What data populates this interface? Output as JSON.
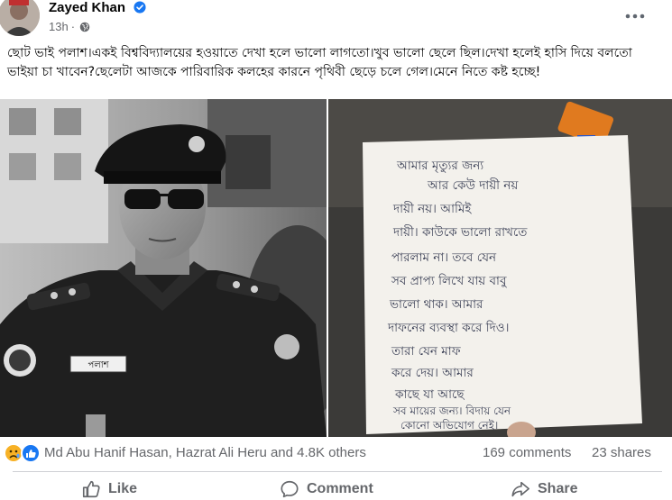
{
  "post": {
    "author": "Zayed Khan",
    "time": "13h",
    "meta_separator": "·",
    "caption": "ছোট ভাই পলাশ।একই বিশ্ববিদ্যালয়ের হওয়াতে দেখা হলে ভালো লাগতো।খুব ভালো ছেলে ছিল।দেখা হলেই হাসি দিয়ে  বলতো ভাইয়া চা খাবেন?ছেলেটা আজকে পারিবারিক কলহের কারনে পৃথিবী ছেড়ে চলে গেল।মেনে নিতে কষ্ট হচ্ছে!",
    "name_tag": "পলাশ",
    "note_lines": [
      "আমার মৃত্যুর জন্য",
      "আর কেউ দায়ী নয়",
      "দায়ী নয়। আমিই",
      "দায়ী। কাউকে ভালো রাখতে",
      "পারলাম না। তবে যেন",
      "সব প্রাপ্য লিখে যায় বাবু",
      "ভালো থাক। আমার",
      "দাফনের ব্যবস্থা করে দিও।",
      "তারা যেন মাফ",
      "করে দেয়। আমার",
      "কাছে যা আছে",
      "সব মায়ের জন্য। বিদায় যেন",
      "কোনো অভিযোগ নেই।"
    ]
  },
  "stats": {
    "reaction_names": "Md Abu Hanif Hasan, Hazrat Ali Heru and 4.8K others",
    "comments": "169 comments",
    "shares": "23 shares"
  },
  "actions": {
    "like": "Like",
    "comment": "Comment",
    "share": "Share"
  },
  "colors": {
    "text_primary": "#050505",
    "text_secondary": "#65676b",
    "verified_blue": "#1877f2",
    "like_blue": "#1877f2",
    "sad_yellow": "#f7b125",
    "divider": "#ced0d4"
  },
  "icons": {
    "verified": "verified-badge-icon",
    "audience": "globe-icon",
    "more": "more-options-icon",
    "reactions": [
      "sad-reaction-icon",
      "like-reaction-icon"
    ],
    "like": "thumbs-up-icon",
    "comment": "comment-bubble-icon",
    "share": "share-arrow-icon"
  }
}
